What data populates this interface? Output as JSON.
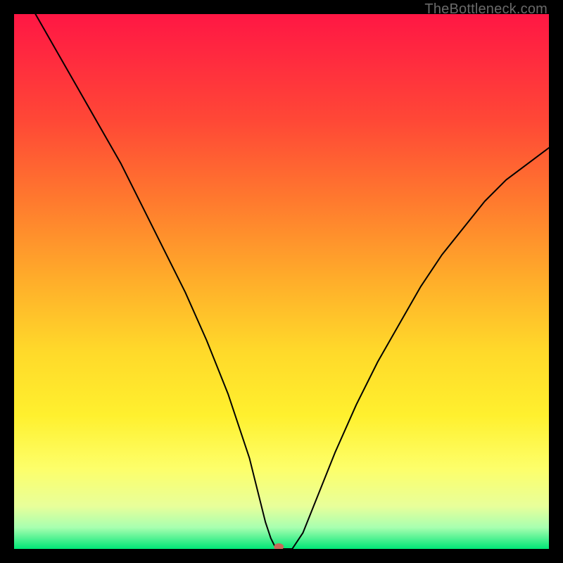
{
  "watermark": "TheBottleneck.com",
  "chart_data": {
    "type": "line",
    "title": "",
    "xlabel": "",
    "ylabel": "",
    "xlim": [
      0,
      100
    ],
    "ylim": [
      0,
      100
    ],
    "grid": false,
    "background_gradient": {
      "stops": [
        {
          "offset": 0.0,
          "color": "#ff1744"
        },
        {
          "offset": 0.08,
          "color": "#ff2a3f"
        },
        {
          "offset": 0.2,
          "color": "#ff4836"
        },
        {
          "offset": 0.35,
          "color": "#ff7a2e"
        },
        {
          "offset": 0.5,
          "color": "#ffae2a"
        },
        {
          "offset": 0.63,
          "color": "#ffd92a"
        },
        {
          "offset": 0.75,
          "color": "#fff02e"
        },
        {
          "offset": 0.85,
          "color": "#fdff6a"
        },
        {
          "offset": 0.92,
          "color": "#e8ff9a"
        },
        {
          "offset": 0.96,
          "color": "#a8ffb0"
        },
        {
          "offset": 1.0,
          "color": "#00e676"
        }
      ]
    },
    "series": [
      {
        "name": "bottleneck-curve",
        "stroke": "#000000",
        "stroke_width": 2,
        "x": [
          0,
          4,
          8,
          12,
          16,
          20,
          24,
          28,
          32,
          36,
          40,
          42,
          44,
          45,
          46,
          47,
          48,
          49,
          50,
          52,
          54,
          56,
          60,
          64,
          68,
          72,
          76,
          80,
          84,
          88,
          92,
          96,
          100
        ],
        "y": [
          106,
          100,
          93,
          86,
          79,
          72,
          64,
          56,
          48,
          39,
          29,
          23,
          17,
          13,
          9,
          5,
          2,
          0,
          0,
          0,
          3,
          8,
          18,
          27,
          35,
          42,
          49,
          55,
          60,
          65,
          69,
          72,
          75
        ]
      }
    ],
    "marker": {
      "name": "optimal-point",
      "x": 49.5,
      "y": 0,
      "rx": 7,
      "ry": 5,
      "fill": "#c86a5a"
    }
  }
}
